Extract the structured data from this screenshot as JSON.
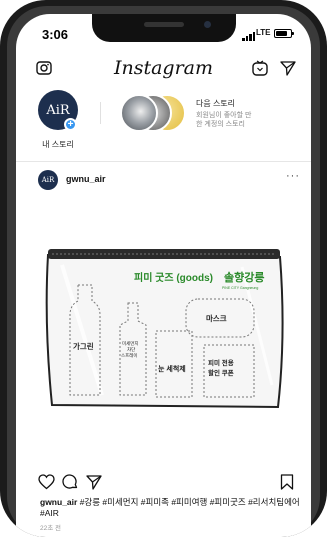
{
  "status_bar": {
    "time": "3:06",
    "network": "LTE",
    "battery_level": 0.8
  },
  "app": {
    "title": "Instagram"
  },
  "stories": {
    "my_story": {
      "avatar_text": "AiR",
      "label": "내 스토리"
    },
    "next": {
      "title": "다음 스토리",
      "subtitle_line1": "회원님이 좋아할 만",
      "subtitle_line2": "한 계정의 스토리"
    }
  },
  "post": {
    "avatar_text": "AiR",
    "username": "gwnu_air",
    "more": "···",
    "image": {
      "brand_line": "피미 굿즈 (goods)",
      "brand_script": "솔향강릉",
      "brand_small": "PINE CITY Gangneung",
      "items": {
        "bottle": "가그린",
        "mask": "마스크",
        "spray_line1": "미세먼지",
        "spray_line2": "차단",
        "spray_line3": "스프레이",
        "eyewash": "눈 세척제",
        "coupon_line1": "피미 전용",
        "coupon_line2": "할인 쿠폰"
      }
    },
    "caption_user": "gwnu_air",
    "caption_text": "#강릉 #미세먼지 #피미족 #피미여행 #피미굿즈 #리서치팀에어 #AIR",
    "time_ago": "22초 전"
  },
  "colors": {
    "accent_blue": "#3897f0",
    "brand_navy": "#1d2f4e",
    "brand_green": "#2a8a2a"
  }
}
